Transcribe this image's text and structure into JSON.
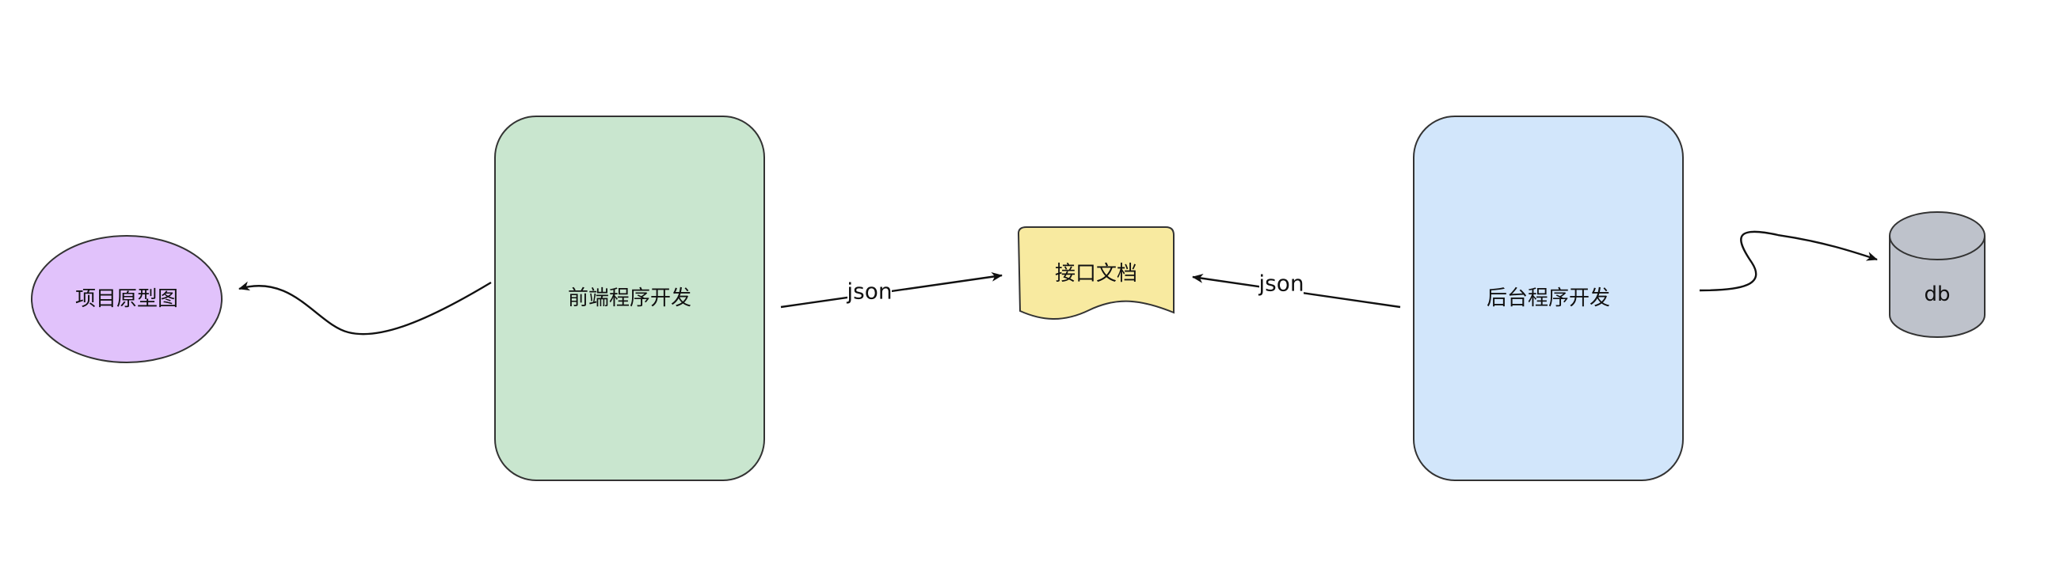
{
  "nodes": {
    "prototype": {
      "label": "项目原型图",
      "fill": "#E1C2FB",
      "stroke": "#333333"
    },
    "frontend": {
      "label": "前端程序开发",
      "fill": "#C9E6CF",
      "stroke": "#333333"
    },
    "api_doc": {
      "label": "接口文档",
      "fill": "#F8EAA0",
      "stroke": "#333333"
    },
    "backend": {
      "label": "后台程序开发",
      "fill": "#D2E6FB",
      "stroke": "#333333"
    },
    "db": {
      "label": "db",
      "fill": "#BEC2CB",
      "stroke": "#333333"
    }
  },
  "edges": {
    "frontend_to_api": {
      "label": "json"
    },
    "backend_to_api": {
      "label": "json"
    }
  }
}
